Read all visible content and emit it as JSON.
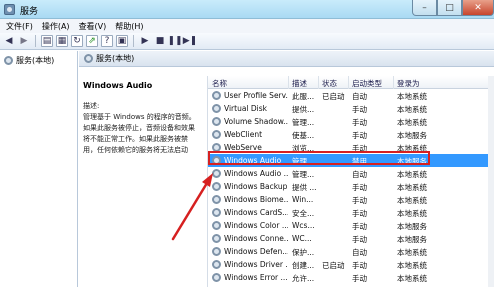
{
  "window": {
    "title": "服务",
    "min_symbol": "–",
    "max_symbol": "□",
    "close_symbol": "✕"
  },
  "menu": {
    "items": [
      "文件(F)",
      "操作(A)",
      "查看(V)",
      "帮助(H)"
    ]
  },
  "toolbar": {
    "icons": [
      "back-icon",
      "forward-icon",
      "console-tree-icon",
      "properties-icon",
      "refresh-icon",
      "export-icon",
      "help-icon",
      "play-icon",
      "stop-icon",
      "pause-icon",
      "restart-icon"
    ]
  },
  "tree": {
    "root_label": "服务(本地)"
  },
  "pane": {
    "header_label": "服务(本地)"
  },
  "description": {
    "service_name": "Windows Audio",
    "label": "描述:",
    "text": "管理基于 Windows 的程序的音频。如果此服务被停止，音频设备和效果将不能正常工作。如果此服务被禁用，任何依赖它的服务将无法启动"
  },
  "table": {
    "columns": [
      "名称",
      "描述",
      "状态",
      "启动类型",
      "登录为"
    ],
    "rows": [
      {
        "name": "User Profile Serv...",
        "desc": "此服...",
        "status": "已启动",
        "startup": "自动",
        "logon": "本地系统"
      },
      {
        "name": "Virtual Disk",
        "desc": "提供...",
        "status": "",
        "startup": "手动",
        "logon": "本地系统"
      },
      {
        "name": "Volume Shadow...",
        "desc": "管理...",
        "status": "",
        "startup": "手动",
        "logon": "本地系统"
      },
      {
        "name": "WebClient",
        "desc": "使基...",
        "status": "",
        "startup": "手动",
        "logon": "本地服务"
      },
      {
        "name": "WebServe",
        "desc": "浏览...",
        "status": "",
        "startup": "手动",
        "logon": "本地系统"
      },
      {
        "name": "Windows Audio",
        "desc": "管理...",
        "status": "",
        "startup": "禁用",
        "logon": "本地服务",
        "selected": true
      },
      {
        "name": "Windows Audio ...",
        "desc": "管理...",
        "status": "",
        "startup": "自动",
        "logon": "本地系统"
      },
      {
        "name": "Windows Backup",
        "desc": "提供 ...",
        "status": "",
        "startup": "手动",
        "logon": "本地系统"
      },
      {
        "name": "Windows Biome...",
        "desc": "Win...",
        "status": "",
        "startup": "手动",
        "logon": "本地系统"
      },
      {
        "name": "Windows CardS...",
        "desc": "安全...",
        "status": "",
        "startup": "手动",
        "logon": "本地系统"
      },
      {
        "name": "Windows Color ...",
        "desc": "Wcs...",
        "status": "",
        "startup": "手动",
        "logon": "本地服务"
      },
      {
        "name": "Windows Conne...",
        "desc": "WC...",
        "status": "",
        "startup": "手动",
        "logon": "本地服务"
      },
      {
        "name": "Windows Defen...",
        "desc": "保护...",
        "status": "",
        "startup": "自动",
        "logon": "本地系统"
      },
      {
        "name": "Windows Driver ...",
        "desc": "创建...",
        "status": "已启动",
        "startup": "手动",
        "logon": "本地系统"
      },
      {
        "name": "Windows Error ...",
        "desc": "允许...",
        "status": "",
        "startup": "手动",
        "logon": "本地系统"
      }
    ]
  },
  "colors": {
    "selection": "#3399ff",
    "annotation": "#d62020"
  }
}
